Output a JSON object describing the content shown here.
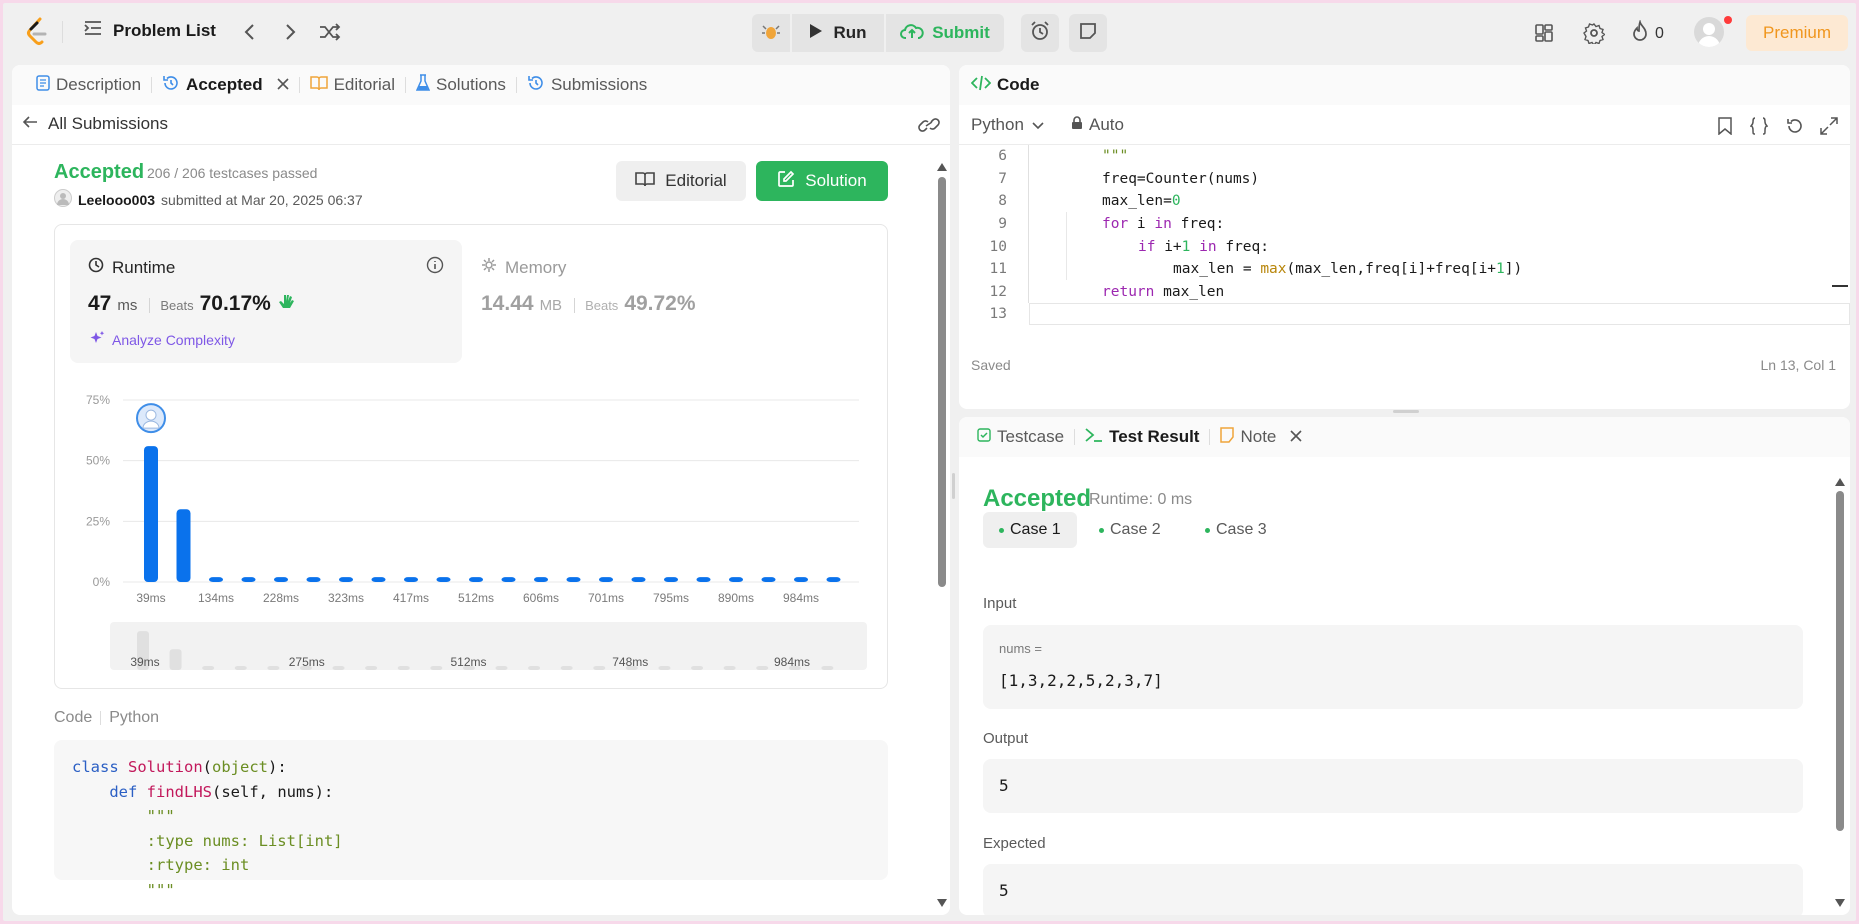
{
  "topbar": {
    "problem_list": "Problem List",
    "run": "Run",
    "submit": "Submit",
    "streak": "0",
    "premium": "Premium"
  },
  "left": {
    "tabs": {
      "description": "Description",
      "accepted": "Accepted",
      "editorial": "Editorial",
      "solutions": "Solutions",
      "submissions": "Submissions"
    },
    "back": "All Submissions",
    "status": "Accepted",
    "testcases": "206 / 206 testcases passed",
    "user": "Leelooo003",
    "submitted_at": "submitted at Mar 20, 2025 06:37",
    "editorial_btn": "Editorial",
    "solution_btn": "Solution",
    "runtime": {
      "label": "Runtime",
      "value": "47",
      "unit": "ms",
      "beats_label": "Beats",
      "beats": "70.17%"
    },
    "memory": {
      "label": "Memory",
      "value": "14.44",
      "unit": "MB",
      "beats_label": "Beats",
      "beats": "49.72%"
    },
    "analyze": "Analyze Complexity",
    "code_label": "Code",
    "code_lang": "Python"
  },
  "chart_data": {
    "type": "bar",
    "ylabel": "",
    "y_ticks": [
      "75%",
      "50%",
      "25%",
      "0%"
    ],
    "ylim": [
      0,
      75
    ],
    "x_tick_labels": [
      "39ms",
      "134ms",
      "228ms",
      "323ms",
      "417ms",
      "512ms",
      "606ms",
      "701ms",
      "795ms",
      "890ms",
      "984ms"
    ],
    "values": [
      56,
      30,
      2,
      2,
      2,
      2,
      2,
      2,
      2,
      2,
      2,
      2,
      2,
      2,
      2,
      2,
      2,
      2,
      2,
      2,
      2,
      2
    ],
    "highlight_index": 0,
    "overview_labels": [
      "39ms",
      "275ms",
      "512ms",
      "748ms",
      "984ms"
    ],
    "grid": true,
    "color": "#0a72ec"
  },
  "right": {
    "code_tab": "Code",
    "lang": "Python",
    "auto": "Auto",
    "saved": "Saved",
    "cursor": "Ln 13, Col 1",
    "tabs": {
      "testcase": "Testcase",
      "result": "Test Result",
      "note": "Note"
    },
    "result_status": "Accepted",
    "result_runtime": "Runtime: 0 ms",
    "cases": [
      "Case 1",
      "Case 2",
      "Case 3"
    ],
    "input_label": "Input",
    "input_var": "nums =",
    "input_value": "[1,3,2,2,5,2,3,7]",
    "output_label": "Output",
    "output_value": "5",
    "expected_label": "Expected",
    "expected_value": "5"
  }
}
